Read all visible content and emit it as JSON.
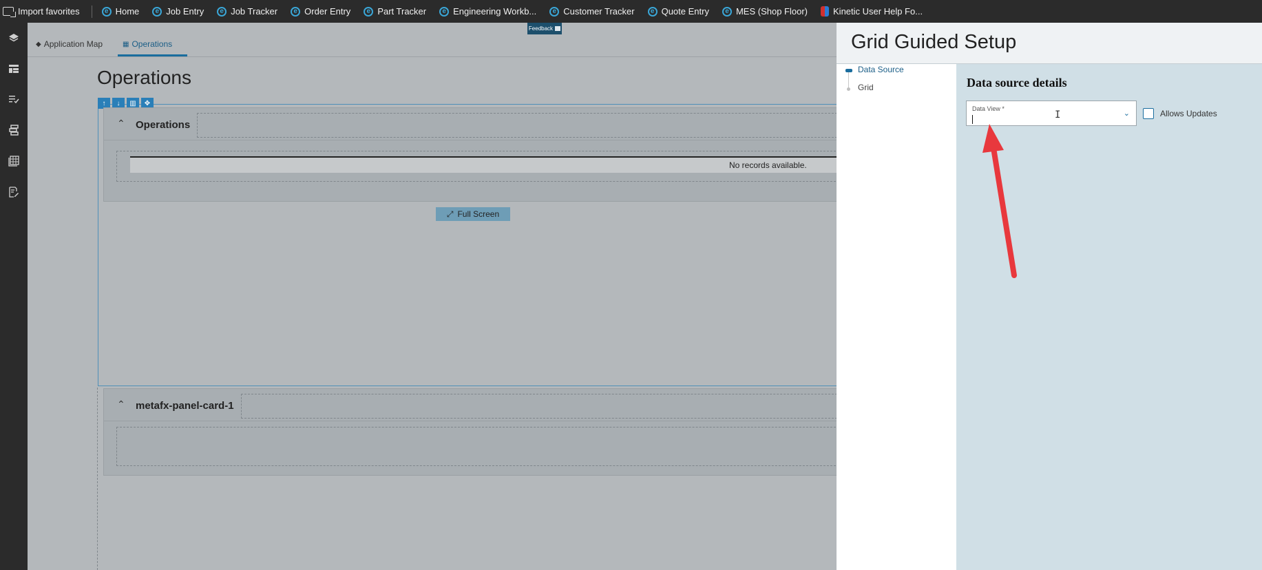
{
  "favorites": [
    {
      "label": "Import favorites",
      "icon": "import-icon"
    },
    {
      "label": "Home",
      "icon": "edge-e-icon"
    },
    {
      "label": "Job Entry",
      "icon": "edge-e-icon"
    },
    {
      "label": "Job Tracker",
      "icon": "edge-e-icon"
    },
    {
      "label": "Order Entry",
      "icon": "edge-e-icon"
    },
    {
      "label": "Part Tracker",
      "icon": "edge-e-icon"
    },
    {
      "label": "Engineering Workb...",
      "icon": "edge-e-icon"
    },
    {
      "label": "Customer Tracker",
      "icon": "edge-e-icon"
    },
    {
      "label": "Quote Entry",
      "icon": "edge-e-icon"
    },
    {
      "label": "MES (Shop Floor)",
      "icon": "edge-e-icon"
    },
    {
      "label": "Kinetic User Help Fo...",
      "icon": "help-icon"
    }
  ],
  "tabs": {
    "app_map": "Application Map",
    "operations": "Operations"
  },
  "feedback": "Feedback",
  "page_title": "Operations",
  "card1": {
    "title": "Operations",
    "empty_text": "No records available.",
    "fullscreen": "Full Screen"
  },
  "card2": {
    "title": "metafx-panel-card-1"
  },
  "panel": {
    "title": "Grid Guided Setup",
    "steps": [
      "Data Source",
      "Grid"
    ],
    "section_title": "Data source details",
    "data_view_label": "Data View *",
    "allows_updates": "Allows Updates"
  },
  "colors": {
    "accent": "#1a6d9e",
    "annotation_arrow": "#e8383d"
  }
}
